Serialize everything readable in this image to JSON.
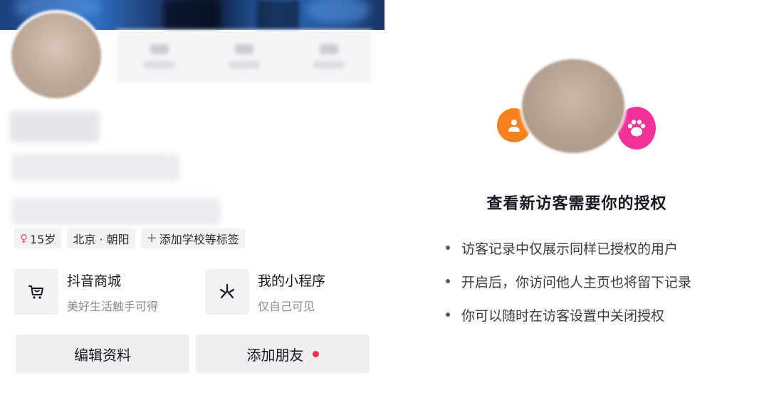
{
  "profile": {
    "tags": {
      "age": "15岁",
      "location": "北京 · 朝阳",
      "add_tag": "添加学校等标签"
    },
    "entries": {
      "shop": {
        "title": "抖音商城",
        "subtitle": "美好生活触手可得",
        "icon": "shopping-cart-icon"
      },
      "mini_program": {
        "title": "我的小程序",
        "subtitle": "仅自己可见",
        "icon": "mini-program-icon"
      }
    },
    "buttons": {
      "edit": "编辑资料",
      "add_friend": "添加朋友"
    }
  },
  "auth_dialog": {
    "title": "查看新访客需要你的授权",
    "icons": [
      "person-icon",
      "paw-icon"
    ],
    "bullets": [
      "访客记录中仅展示同样已授权的用户",
      "开启后，你访问他人主页也将留下记录",
      "你可以随时在访客设置中关闭授权"
    ]
  },
  "colors": {
    "accent_red": "#fe2c55",
    "orange": "#f5821f",
    "pink": "#f0319a"
  }
}
